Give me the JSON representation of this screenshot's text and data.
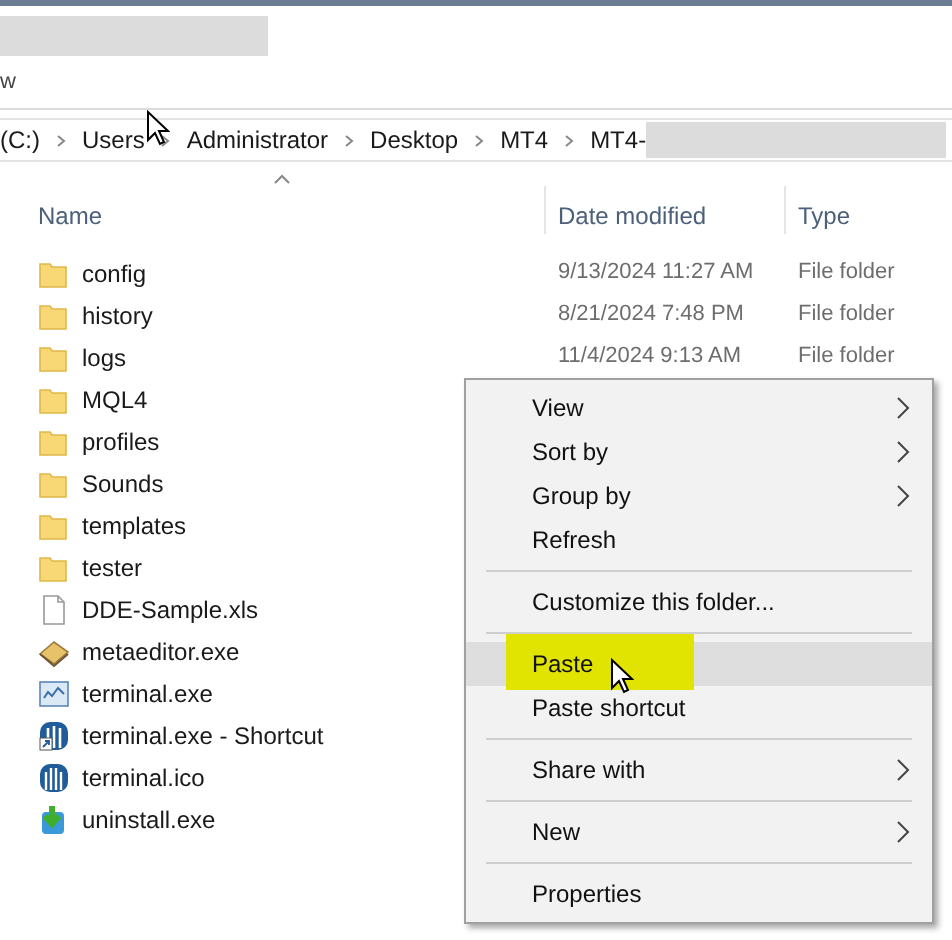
{
  "ribbon": {
    "tab": "w"
  },
  "address_bar": {
    "crumbs": [
      "(C:)",
      "Users",
      "Administrator",
      "Desktop",
      "MT4",
      "MT4-"
    ]
  },
  "columns": [
    {
      "label": "Name",
      "sorted": true
    },
    {
      "label": "Date modified",
      "sorted": false
    },
    {
      "label": "Type",
      "sorted": false
    }
  ],
  "rows": [
    {
      "kind": "folder",
      "name": "config",
      "date": "9/13/2024 11:27 AM",
      "type": "File folder"
    },
    {
      "kind": "folder",
      "name": "history",
      "date": "8/21/2024 7:48 PM",
      "type": "File folder"
    },
    {
      "kind": "folder",
      "name": "logs",
      "date": "11/4/2024 9:13 AM",
      "type": "File folder"
    },
    {
      "kind": "folder",
      "name": "MQL4"
    },
    {
      "kind": "folder",
      "name": "profiles"
    },
    {
      "kind": "folder",
      "name": "Sounds"
    },
    {
      "kind": "folder",
      "name": "templates"
    },
    {
      "kind": "folder",
      "name": "tester"
    },
    {
      "kind": "document",
      "name": "DDE-Sample.xls"
    },
    {
      "kind": "editor",
      "name": "metaeditor.exe"
    },
    {
      "kind": "program",
      "name": "terminal.exe"
    },
    {
      "kind": "shortcut",
      "name": "terminal.exe - Shortcut"
    },
    {
      "kind": "ico",
      "name": "terminal.ico"
    },
    {
      "kind": "installer",
      "name": "uninstall.exe"
    }
  ],
  "context_menu": [
    {
      "kind": "item",
      "label": "View",
      "submenu": true,
      "selected": false,
      "highlighted": false
    },
    {
      "kind": "item",
      "label": "Sort by",
      "submenu": true,
      "selected": false,
      "highlighted": false
    },
    {
      "kind": "item",
      "label": "Group by",
      "submenu": true,
      "selected": false,
      "highlighted": false
    },
    {
      "kind": "item",
      "label": "Refresh",
      "submenu": false,
      "selected": false,
      "highlighted": false
    },
    {
      "kind": "separator"
    },
    {
      "kind": "item",
      "label": "Customize this folder...",
      "submenu": false,
      "selected": false,
      "highlighted": false
    },
    {
      "kind": "separator"
    },
    {
      "kind": "item",
      "label": "Paste",
      "submenu": false,
      "selected": true,
      "highlighted": true
    },
    {
      "kind": "item",
      "label": "Paste shortcut",
      "submenu": false,
      "selected": false,
      "highlighted": false
    },
    {
      "kind": "separator"
    },
    {
      "kind": "item",
      "label": "Share with",
      "submenu": true,
      "selected": false,
      "highlighted": false
    },
    {
      "kind": "separator"
    },
    {
      "kind": "item",
      "label": "New",
      "submenu": true,
      "selected": false,
      "highlighted": false
    },
    {
      "kind": "separator"
    },
    {
      "kind": "item",
      "label": "Properties",
      "submenu": false,
      "selected": false,
      "highlighted": false
    }
  ]
}
